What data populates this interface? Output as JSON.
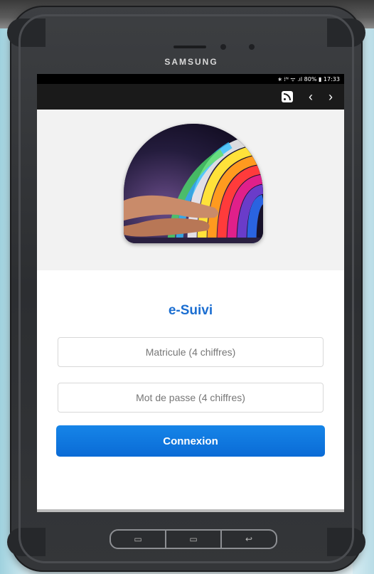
{
  "device": {
    "brand": "SAMSUNG",
    "status_bar": "∗ ⁞ᴺ ᯤ .ıl 80% ▮ 17:33"
  },
  "toolbar": {
    "rss_icon": "rss-icon",
    "back_label": "‹",
    "forward_label": "›"
  },
  "app": {
    "title": "e-Suivi",
    "matricule": {
      "placeholder": "Matricule (4 chiffres)",
      "value": ""
    },
    "password": {
      "placeholder": "Mot de passe (4 chiffres)",
      "value": ""
    },
    "submit_label": "Connexion"
  },
  "hardware_keys": {
    "recent": "▭",
    "home": "▭",
    "back": "↩"
  },
  "colors": {
    "accent": "#1b6ed1",
    "button": "#0a6bd6",
    "toolbar": "#1a1a1a"
  }
}
